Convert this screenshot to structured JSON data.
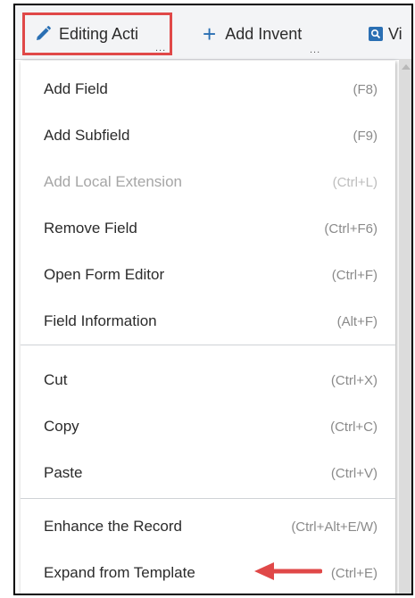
{
  "toolbar": {
    "editing_label": "Editing Acti",
    "editing_dots": "...",
    "add_label": "Add Invent",
    "add_dots": "...",
    "view_label": "Vi"
  },
  "menu": {
    "items": [
      {
        "label": "Add Field",
        "shortcut": "(F8)",
        "enabled": true
      },
      {
        "label": "Add Subfield",
        "shortcut": "(F9)",
        "enabled": true
      },
      {
        "label": "Add Local Extension",
        "shortcut": "(Ctrl+L)",
        "enabled": false
      },
      {
        "label": "Remove Field",
        "shortcut": "(Ctrl+F6)",
        "enabled": true
      },
      {
        "label": "Open Form Editor",
        "shortcut": "(Ctrl+F)",
        "enabled": true
      },
      {
        "label": "Field Information",
        "shortcut": "(Alt+F)",
        "enabled": true
      },
      {
        "label": "Cut",
        "shortcut": "(Ctrl+X)",
        "enabled": true
      },
      {
        "label": "Copy",
        "shortcut": "(Ctrl+C)",
        "enabled": true
      },
      {
        "label": "Paste",
        "shortcut": "(Ctrl+V)",
        "enabled": true
      },
      {
        "label": "Enhance the Record",
        "shortcut": "(Ctrl+Alt+E/W)",
        "enabled": true
      },
      {
        "label": "Expand from Template",
        "shortcut": "(Ctrl+E)",
        "enabled": true
      }
    ]
  },
  "icons": {
    "editing": "pencil-icon",
    "add": "plus-icon",
    "view": "search-icon",
    "annotation": "arrow-left-icon"
  },
  "colors": {
    "highlight_border": "#e04848",
    "annotation_arrow": "#e04848",
    "icon_blue": "#2a6fb3",
    "disabled_text": "#a6a6a6"
  }
}
